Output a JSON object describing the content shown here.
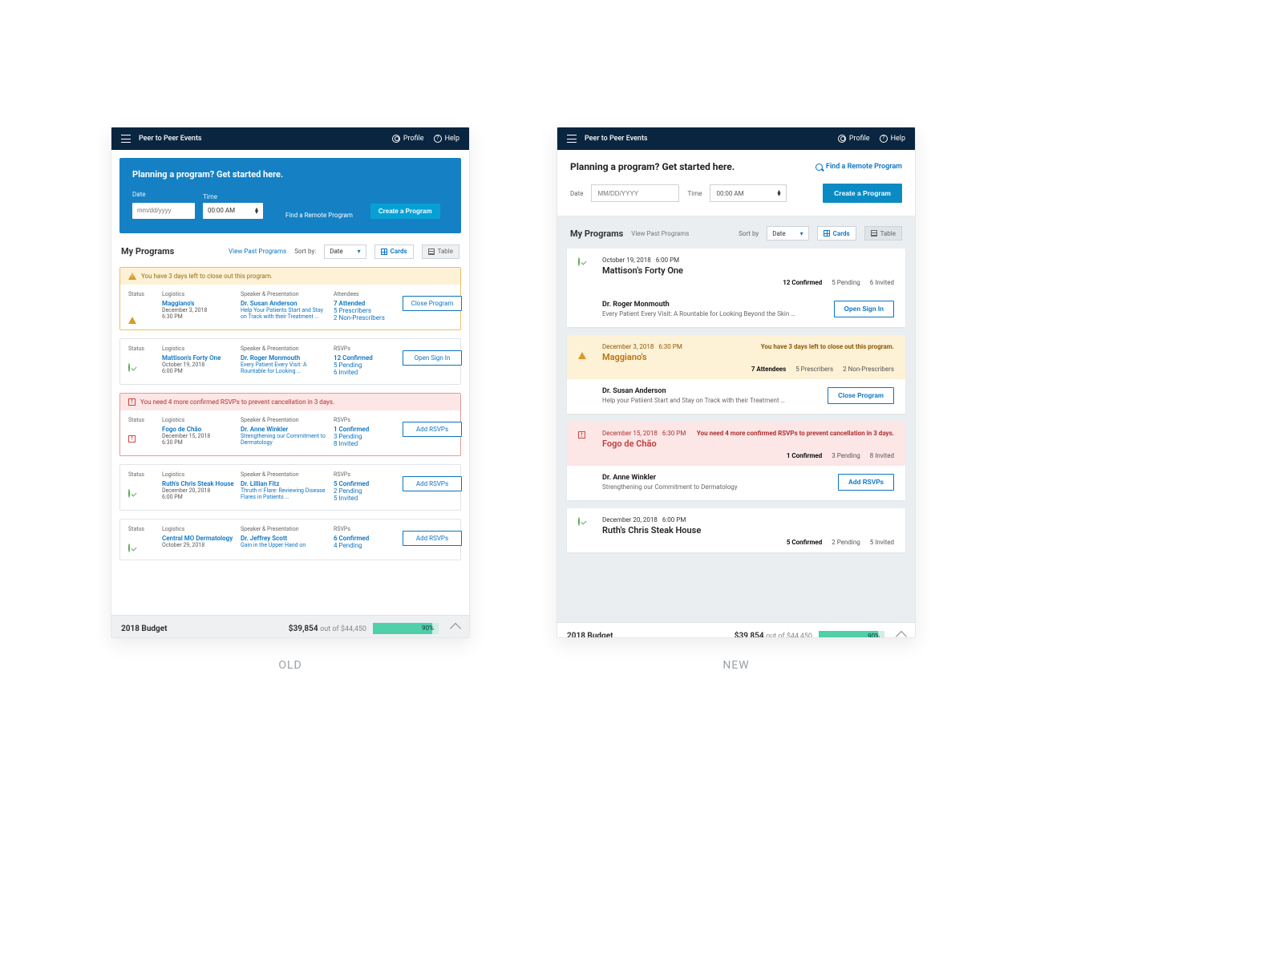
{
  "header": {
    "app": "Peer to Peer Events",
    "profile": "Profile",
    "help": "Help"
  },
  "captions": {
    "old": "OLD",
    "new": "NEW"
  },
  "old": {
    "hero": {
      "title": "Planning a program? Get started here.",
      "date_label": "Date",
      "date_ph": "mm/dd/yyyy",
      "time_label": "Time",
      "time_val": "00:00 AM",
      "find": "Find a Remote Program",
      "create": "Create a Program"
    },
    "section": {
      "title": "My Programs",
      "view_past": "View Past Programs",
      "sort_label": "Sort by:",
      "sort_val": "Date",
      "cards": "Cards",
      "table": "Table"
    },
    "cols": {
      "status": "Status",
      "logistics": "Logistics",
      "sp": "Speaker & Presentation",
      "attendees": "Attendees",
      "rsvps": "RSVPs"
    },
    "cards": [
      {
        "banner_type": "warn",
        "banner": "You have 3 days left to close out this program.",
        "status": "warn",
        "venue": "Maggiano's",
        "date": "December 3, 2018",
        "time": "6:30 PM",
        "speaker": "Dr. Susan Anderson",
        "talk": "Help Your Patients Start and Stay on Track with their Treatment …",
        "col4": "attendees",
        "m1": "7 Attended",
        "m2": "5 Prescribers",
        "m3": "2 Non-Prescribers",
        "action": "Close Program"
      },
      {
        "status": "ok",
        "venue": "Mattison's Forty One",
        "date": "October 19, 2018",
        "time": "6:00 PM",
        "speaker": "Dr. Roger Monmouth",
        "talk": "Every Patient Every Visit: A Rountable for Looking …",
        "col4": "rsvps",
        "m1": "12 Confirmed",
        "m2": "5 Pending",
        "m3": "6 Invited",
        "action": "Open Sign In"
      },
      {
        "banner_type": "err",
        "banner": "You need 4 more confirmed RSVPs to prevent cancellation in 3 days.",
        "status": "err",
        "venue": "Fogo de Chão",
        "date": "December 15, 2018",
        "time": "6:30 PM",
        "speaker": "Dr. Anne Winkler",
        "talk": "Strengthening our Commitment to Dermatology",
        "col4": "rsvps",
        "m1": "1 Confirmed",
        "m2": "3 Pending",
        "m3": "8 Invited",
        "action": "Add RSVPs"
      },
      {
        "status": "ok",
        "venue": "Ruth's Chris Steak House",
        "date": "December 20, 2018",
        "time": "6:00 PM",
        "speaker": "Dr. Lillian Fitz",
        "talk": "Thruth n' Flare: Reviewing Disease Flares in Patients …",
        "col4": "rsvps",
        "m1": "5 Confirmed",
        "m2": "2 Pending",
        "m3": "5 Invited",
        "action": "Add RSVPs"
      },
      {
        "status": "ok",
        "venue": "Central MO Dermatology",
        "date": "October 29, 2018",
        "time": "",
        "speaker": "Dr. Jeffrey Scott",
        "talk": "Gain in the Upper Hand on",
        "col4": "rsvps",
        "m1": "6 Confirmed",
        "m2": "4 Pending",
        "m3": "",
        "action": "Add RSVPs"
      }
    ]
  },
  "new": {
    "hero": {
      "title": "Planning a program? Get started here.",
      "find": "Find a Remote Program",
      "date_label": "Date",
      "date_ph": "MM/DD/YYYY",
      "time_label": "Time",
      "time_val": "00:00 AM",
      "create": "Create a Program"
    },
    "section": {
      "title": "My Programs",
      "view_past": "View Past Programs",
      "sort_label": "Sort by",
      "sort_val": "Date",
      "cards": "Cards",
      "table": "Table"
    },
    "cards": [
      {
        "type": "ok",
        "date": "October 19, 2018",
        "time": "6:00 PM",
        "title": "Mattison's Forty One",
        "stats": [
          "12 Confirmed",
          "5 Pending",
          "6 Invited"
        ],
        "speaker": "Dr. Roger Monmouth",
        "desc": "Every Patient Every Visit: A Rountable for Looking Beyond the Skin …",
        "action": "Open Sign In"
      },
      {
        "type": "warn",
        "date": "December 3, 2018",
        "time": "6:30 PM",
        "title": "Maggiano's",
        "alert": "You have 3 days left to close out this program.",
        "stats": [
          "7 Attendees",
          "5 Prescribers",
          "2 Non-Prescribers"
        ],
        "speaker": "Dr. Susan Anderson",
        "desc": "Help your Patiient Start and Stay on Track with their Treatment …",
        "action": "Close Program"
      },
      {
        "type": "err",
        "date": "December 15, 2018",
        "time": "6:30 PM",
        "title": "Fogo de Chão",
        "alert": "You need 4 more confirmed RSVPs to prevent cancellation in 3 days.",
        "stats": [
          "1 Confirmed",
          "3 Pending",
          "8 Invited"
        ],
        "speaker": "Dr. Anne Winkler",
        "desc": "Strengthening our Commitment to Dermatology",
        "action": "Add RSVPs"
      },
      {
        "type": "ok",
        "date": "December 20, 2018",
        "time": "6:00 PM",
        "title": "Ruth's Chris Steak House",
        "stats": [
          "5 Confirmed",
          "2 Pending",
          "5 Invited"
        ],
        "speaker": "",
        "desc": "",
        "action": ""
      }
    ]
  },
  "budget": {
    "label": "2018 Budget",
    "amount": "$39,854",
    "total": "out of $44,450",
    "pct": "90%",
    "fill": 90
  }
}
